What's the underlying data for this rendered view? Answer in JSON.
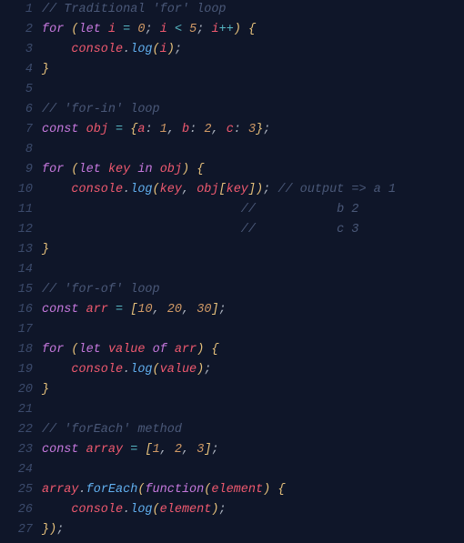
{
  "lineCount": 27,
  "code": {
    "l1": [
      [
        "// Traditional 'for' loop",
        "comment"
      ]
    ],
    "l2": [
      [
        "for",
        "keyword"
      ],
      [
        " ",
        "punct"
      ],
      [
        "(",
        "yellow"
      ],
      [
        "let",
        "keyword"
      ],
      [
        " ",
        "punct"
      ],
      [
        "i",
        "ident"
      ],
      [
        " ",
        "punct"
      ],
      [
        "=",
        "op"
      ],
      [
        " ",
        "punct"
      ],
      [
        "0",
        "num"
      ],
      [
        ";",
        "punct"
      ],
      [
        " ",
        "punct"
      ],
      [
        "i",
        "ident"
      ],
      [
        " ",
        "punct"
      ],
      [
        "<",
        "op"
      ],
      [
        " ",
        "punct"
      ],
      [
        "5",
        "num"
      ],
      [
        ";",
        "punct"
      ],
      [
        " ",
        "punct"
      ],
      [
        "i",
        "ident"
      ],
      [
        "++",
        "op"
      ],
      [
        ")",
        "yellow"
      ],
      [
        " ",
        "punct"
      ],
      [
        "{",
        "yellow"
      ]
    ],
    "l3": [
      [
        "    ",
        "punct"
      ],
      [
        "console",
        "ident"
      ],
      [
        ".",
        "punct"
      ],
      [
        "log",
        "func"
      ],
      [
        "(",
        "yellow"
      ],
      [
        "i",
        "ident"
      ],
      [
        ")",
        "yellow"
      ],
      [
        ";",
        "punct"
      ]
    ],
    "l4": [
      [
        "}",
        "yellow"
      ]
    ],
    "l5": [],
    "l6": [
      [
        "// 'for-in' loop",
        "comment"
      ]
    ],
    "l7": [
      [
        "const",
        "keyword"
      ],
      [
        " ",
        "punct"
      ],
      [
        "obj",
        "ident"
      ],
      [
        " ",
        "punct"
      ],
      [
        "=",
        "op"
      ],
      [
        " ",
        "punct"
      ],
      [
        "{",
        "yellow"
      ],
      [
        "a",
        "prop"
      ],
      [
        ":",
        "punct"
      ],
      [
        " ",
        "punct"
      ],
      [
        "1",
        "num"
      ],
      [
        ",",
        "punct"
      ],
      [
        " ",
        "punct"
      ],
      [
        "b",
        "prop"
      ],
      [
        ":",
        "punct"
      ],
      [
        " ",
        "punct"
      ],
      [
        "2",
        "num"
      ],
      [
        ",",
        "punct"
      ],
      [
        " ",
        "punct"
      ],
      [
        "c",
        "prop"
      ],
      [
        ":",
        "punct"
      ],
      [
        " ",
        "punct"
      ],
      [
        "3",
        "num"
      ],
      [
        "}",
        "yellow"
      ],
      [
        ";",
        "punct"
      ]
    ],
    "l8": [],
    "l9": [
      [
        "for",
        "keyword"
      ],
      [
        " ",
        "punct"
      ],
      [
        "(",
        "yellow"
      ],
      [
        "let",
        "keyword"
      ],
      [
        " ",
        "punct"
      ],
      [
        "key",
        "ident"
      ],
      [
        " ",
        "punct"
      ],
      [
        "in",
        "keyword"
      ],
      [
        " ",
        "punct"
      ],
      [
        "obj",
        "ident"
      ],
      [
        ")",
        "yellow"
      ],
      [
        " ",
        "punct"
      ],
      [
        "{",
        "yellow"
      ]
    ],
    "l10": [
      [
        "    ",
        "punct"
      ],
      [
        "console",
        "ident"
      ],
      [
        ".",
        "punct"
      ],
      [
        "log",
        "func"
      ],
      [
        "(",
        "yellow"
      ],
      [
        "key",
        "ident"
      ],
      [
        ",",
        "punct"
      ],
      [
        " ",
        "punct"
      ],
      [
        "obj",
        "ident"
      ],
      [
        "[",
        "yellow"
      ],
      [
        "key",
        "ident"
      ],
      [
        "]",
        "yellow"
      ],
      [
        ")",
        "yellow"
      ],
      [
        ";",
        "punct"
      ],
      [
        " ",
        "punct"
      ],
      [
        "// output => a 1",
        "comment"
      ]
    ],
    "l11": [
      [
        "                           ",
        "punct"
      ],
      [
        "//           b 2",
        "comment"
      ]
    ],
    "l12": [
      [
        "                           ",
        "punct"
      ],
      [
        "//           c 3",
        "comment"
      ]
    ],
    "l13": [
      [
        "}",
        "yellow"
      ]
    ],
    "l14": [],
    "l15": [
      [
        "// 'for-of' loop",
        "comment"
      ]
    ],
    "l16": [
      [
        "const",
        "keyword"
      ],
      [
        " ",
        "punct"
      ],
      [
        "arr",
        "ident"
      ],
      [
        " ",
        "punct"
      ],
      [
        "=",
        "op"
      ],
      [
        " ",
        "punct"
      ],
      [
        "[",
        "yellow"
      ],
      [
        "10",
        "num"
      ],
      [
        ",",
        "punct"
      ],
      [
        " ",
        "punct"
      ],
      [
        "20",
        "num"
      ],
      [
        ",",
        "punct"
      ],
      [
        " ",
        "punct"
      ],
      [
        "30",
        "num"
      ],
      [
        "]",
        "yellow"
      ],
      [
        ";",
        "punct"
      ]
    ],
    "l17": [],
    "l18": [
      [
        "for",
        "keyword"
      ],
      [
        " ",
        "punct"
      ],
      [
        "(",
        "yellow"
      ],
      [
        "let",
        "keyword"
      ],
      [
        " ",
        "punct"
      ],
      [
        "value",
        "ident"
      ],
      [
        " ",
        "punct"
      ],
      [
        "of",
        "keyword"
      ],
      [
        " ",
        "punct"
      ],
      [
        "arr",
        "ident"
      ],
      [
        ")",
        "yellow"
      ],
      [
        " ",
        "punct"
      ],
      [
        "{",
        "yellow"
      ]
    ],
    "l19": [
      [
        "    ",
        "punct"
      ],
      [
        "console",
        "ident"
      ],
      [
        ".",
        "punct"
      ],
      [
        "log",
        "func"
      ],
      [
        "(",
        "yellow"
      ],
      [
        "value",
        "ident"
      ],
      [
        ")",
        "yellow"
      ],
      [
        ";",
        "punct"
      ]
    ],
    "l20": [
      [
        "}",
        "yellow"
      ]
    ],
    "l21": [],
    "l22": [
      [
        "// 'forEach' method",
        "comment"
      ]
    ],
    "l23": [
      [
        "const",
        "keyword"
      ],
      [
        " ",
        "punct"
      ],
      [
        "array",
        "ident"
      ],
      [
        " ",
        "punct"
      ],
      [
        "=",
        "op"
      ],
      [
        " ",
        "punct"
      ],
      [
        "[",
        "yellow"
      ],
      [
        "1",
        "num"
      ],
      [
        ",",
        "punct"
      ],
      [
        " ",
        "punct"
      ],
      [
        "2",
        "num"
      ],
      [
        ",",
        "punct"
      ],
      [
        " ",
        "punct"
      ],
      [
        "3",
        "num"
      ],
      [
        "]",
        "yellow"
      ],
      [
        ";",
        "punct"
      ]
    ],
    "l24": [],
    "l25": [
      [
        "array",
        "ident"
      ],
      [
        ".",
        "punct"
      ],
      [
        "forEach",
        "func"
      ],
      [
        "(",
        "yellow"
      ],
      [
        "function",
        "keyword"
      ],
      [
        "(",
        "yellow"
      ],
      [
        "element",
        "ident"
      ],
      [
        ")",
        "yellow"
      ],
      [
        " ",
        "punct"
      ],
      [
        "{",
        "yellow"
      ]
    ],
    "l26": [
      [
        "    ",
        "punct"
      ],
      [
        "console",
        "ident"
      ],
      [
        ".",
        "punct"
      ],
      [
        "log",
        "func"
      ],
      [
        "(",
        "yellow"
      ],
      [
        "element",
        "ident"
      ],
      [
        ")",
        "yellow"
      ],
      [
        ";",
        "punct"
      ]
    ],
    "l27": [
      [
        "}",
        "yellow"
      ],
      [
        ")",
        "yellow"
      ],
      [
        ";",
        "punct"
      ]
    ]
  }
}
